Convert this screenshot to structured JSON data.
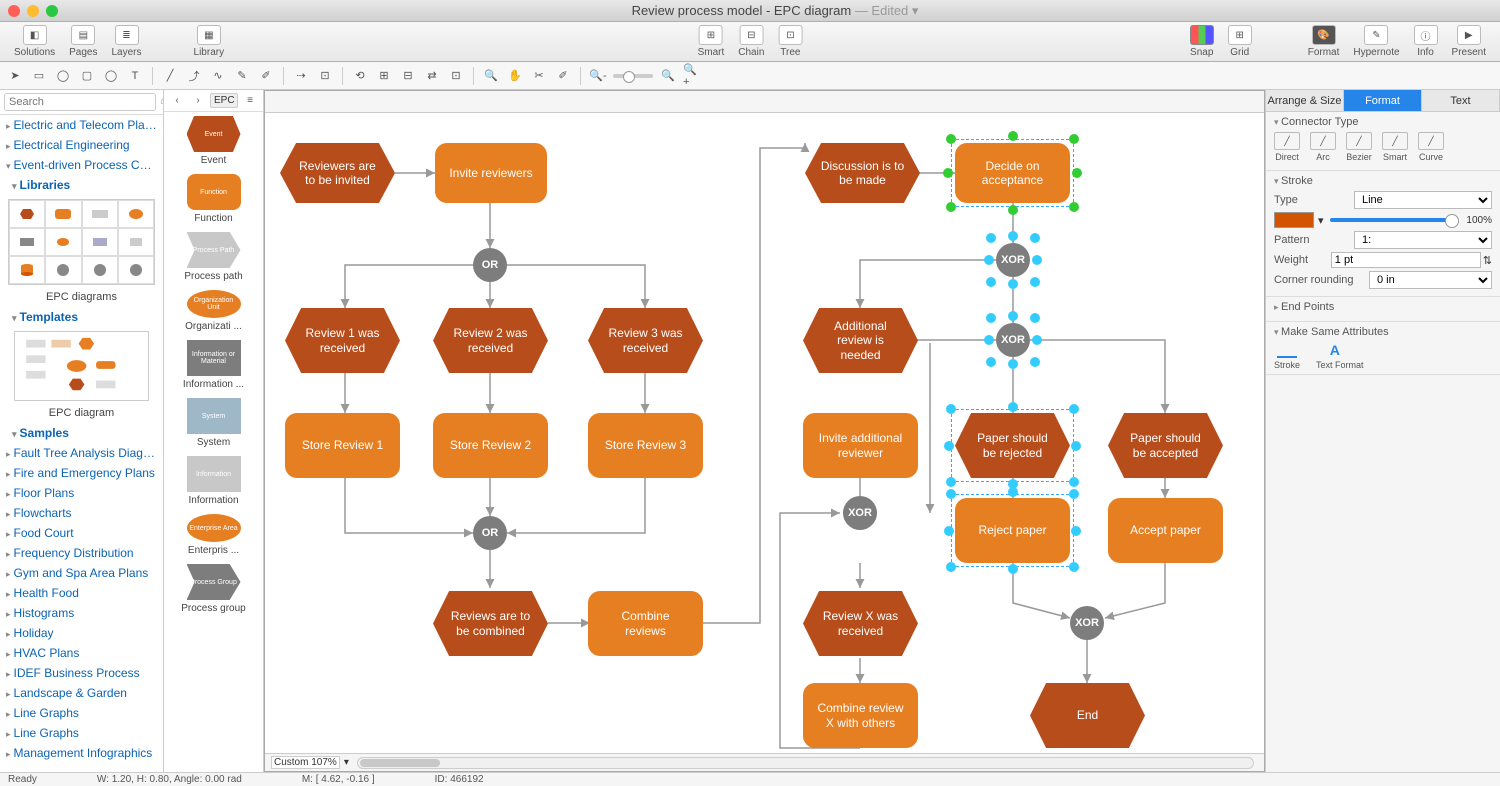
{
  "title": {
    "main": "Review process model - EPC diagram",
    "suffix": " — Edited ▾"
  },
  "toolbar": {
    "left": [
      "Solutions",
      "Pages",
      "Layers"
    ],
    "left2": [
      "Library"
    ],
    "center": [
      "Smart",
      "Chain",
      "Tree"
    ],
    "right1": [
      "Snap",
      "Grid"
    ],
    "right2": [
      "Format",
      "Hypernote",
      "Info",
      "Present"
    ]
  },
  "search_placeholder": "Search",
  "nav": {
    "top": [
      "Electric and Telecom Plans",
      "Electrical Engineering",
      "Event-driven Process Chain"
    ],
    "libraries_label": "Libraries",
    "lib_thumb_label": "EPC diagrams",
    "templates_label": "Templates",
    "template_thumb_label": "EPC diagram",
    "samples_label": "Samples",
    "samples": [
      "Fault Tree Analysis Diagrams",
      "Fire and Emergency Plans",
      "Floor Plans",
      "Flowcharts",
      "Food Court",
      "Frequency Distribution",
      "Gym and Spa Area Plans",
      "Health Food",
      "Histograms",
      "Holiday",
      "HVAC Plans",
      "IDEF Business Process",
      "Landscape & Garden",
      "Line Graphs",
      "Line Graphs",
      "Management Infographics"
    ]
  },
  "lib_tab": "EPC di...",
  "lib_items": [
    {
      "label": "Event",
      "text": "Event",
      "kind": "hex",
      "color": "#b84d1c"
    },
    {
      "label": "Function",
      "text": "Function",
      "kind": "round",
      "color": "#e67e22"
    },
    {
      "label": "Process path",
      "text": "Process Path",
      "kind": "arrow",
      "color": "#c8c8c8"
    },
    {
      "label": "Organizati ...",
      "text": "Organization Unit",
      "kind": "ellipse",
      "color": "#e67e22"
    },
    {
      "label": "Information ...",
      "text": "Information or Material",
      "kind": "rect",
      "color": "#7d7d7d"
    },
    {
      "label": "System",
      "text": "System",
      "kind": "rect",
      "color": "#9eb8c8"
    },
    {
      "label": "Information",
      "text": "Information",
      "kind": "rect",
      "color": "#c8c8c8"
    },
    {
      "label": "Enterpris ...",
      "text": "Enterprise Area",
      "kind": "ellipse",
      "color": "#e67e22"
    },
    {
      "label": "Process group",
      "text": "Process Group",
      "kind": "arrow",
      "color": "#7d7d7d"
    }
  ],
  "shapes": {
    "reviewers_invited": "Reviewers are to be invited",
    "invite_reviewers": "Invite reviewers",
    "or1": "OR",
    "review1": "Review 1 was received",
    "review2": "Review 2 was received",
    "review3": "Review 3 was received",
    "store1": "Store Review 1",
    "store2": "Store Review 2",
    "store3": "Store Review 3",
    "or2": "OR",
    "reviews_combined": "Reviews are to be combined",
    "combine": "Combine reviews",
    "discussion": "Discussion is to be made",
    "decide": "Decide on acceptance",
    "xor1": "XOR",
    "additional_needed": "Additional review is needed",
    "xor2": "XOR",
    "invite_additional": "Invite additional reviewer",
    "paper_reject": "Paper should be rejected",
    "paper_accept": "Paper should be accepted",
    "xor3": "XOR",
    "reject": "Reject paper",
    "accept": "Accept paper",
    "reviewx": "Review X was received",
    "combinex": "Combine review X with others",
    "xor4": "XOR",
    "end": "End"
  },
  "rp": {
    "tabs": [
      "Arrange & Size",
      "Format",
      "Text"
    ],
    "conn_type_h": "Connector Type",
    "conns": [
      "Direct",
      "Arc",
      "Bezier",
      "Smart",
      "Curve"
    ],
    "stroke_h": "Stroke",
    "type_lbl": "Type",
    "type_val": "Line",
    "pct": "100%",
    "pattern_lbl": "Pattern",
    "pattern_val": "1:",
    "weight_lbl": "Weight",
    "weight_val": "1 pt",
    "corner_lbl": "Corner rounding",
    "corner_val": "0 in",
    "endpoints_h": "End Points",
    "msa_h": "Make Same Attributes",
    "msa": [
      "Stroke",
      "Text Format"
    ]
  },
  "canvas_footer": {
    "zoom": "Custom 107%"
  },
  "status": {
    "ready": "Ready",
    "wh": "W: 1.20,  H: 0.80,  Angle: 0.00 rad",
    "m": "M: [ 4.62, -0.16 ]",
    "id": "ID: 466192"
  }
}
